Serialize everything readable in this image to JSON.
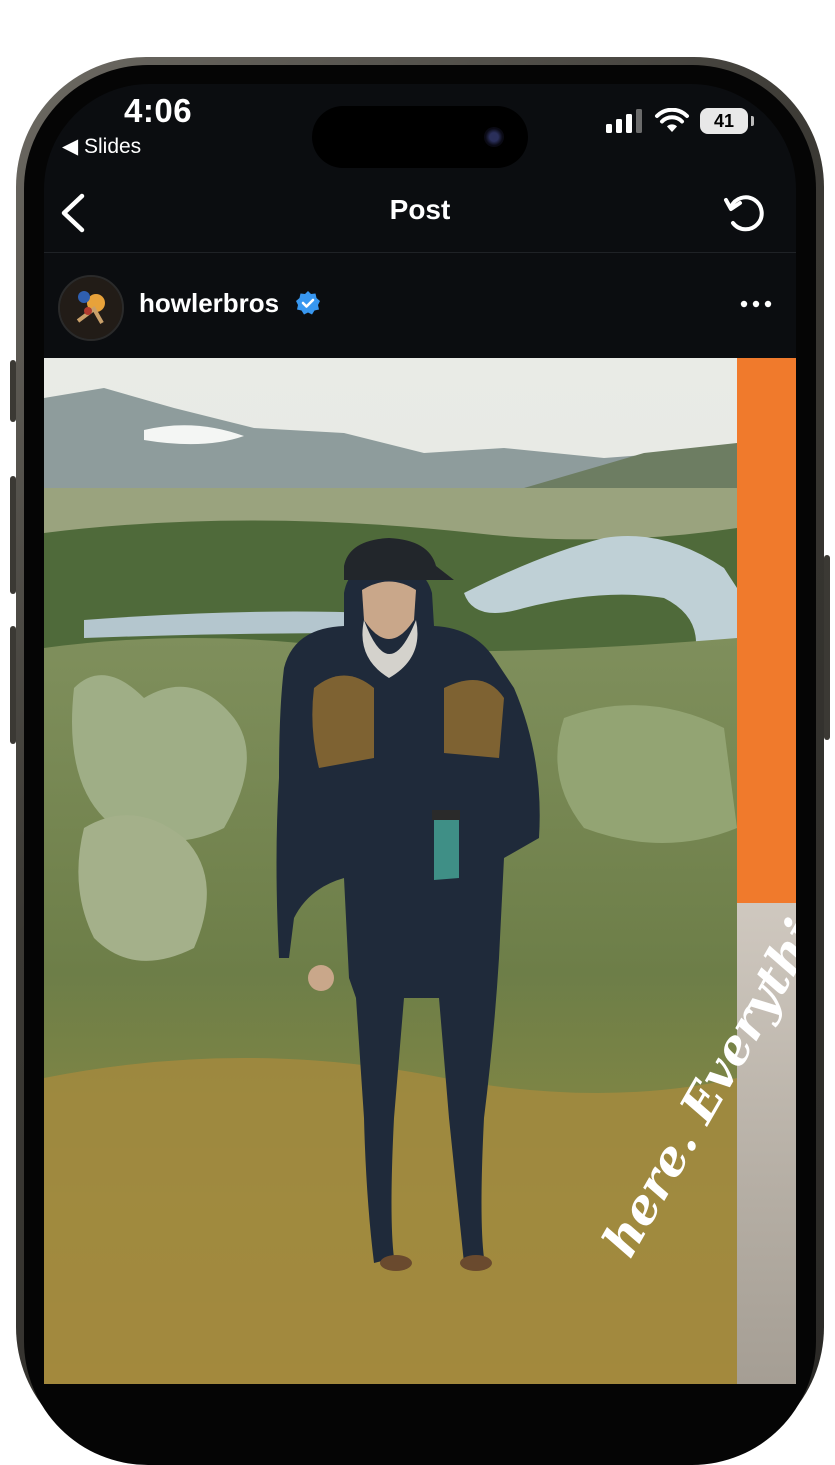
{
  "status_bar": {
    "time": "4:06",
    "back_app": "◀ Slides",
    "battery_level": "41"
  },
  "nav": {
    "title": "Post"
  },
  "post": {
    "username": "howlerbros",
    "verified": true,
    "image_overlay_text": "Everything is",
    "image_overlay_text_2": "here."
  },
  "colors": {
    "background": "#0b0d10",
    "verified_badge": "#3897f0",
    "orange_panel": "#f07a2c"
  }
}
